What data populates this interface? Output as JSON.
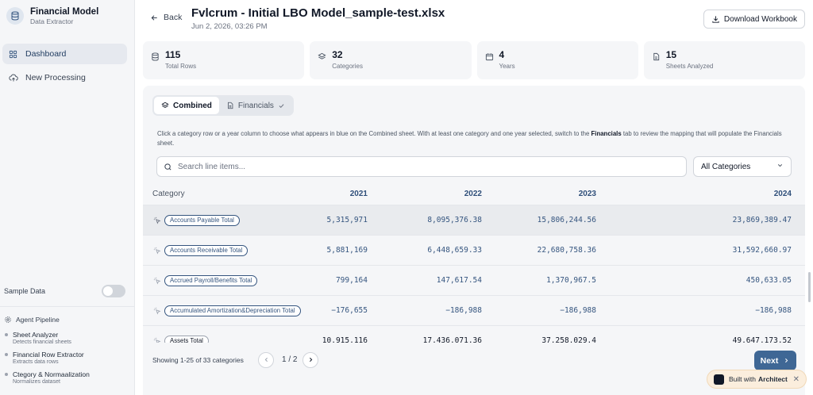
{
  "sidebar": {
    "app_title": "Financial Model",
    "app_subtitle": "Data Extractor",
    "nav": [
      {
        "label": "Dashboard",
        "icon": "grid-icon",
        "active": true
      },
      {
        "label": "New Processing",
        "icon": "cloud-upload-icon",
        "active": false
      }
    ],
    "sample_data_label": "Sample Data",
    "sample_data_on": false,
    "pipeline_title": "Agent Pipeline",
    "pipeline": [
      {
        "name": "Sheet Analyzer",
        "desc": "Detects financial sheets"
      },
      {
        "name": "Financial Row Extractor",
        "desc": "Extracts data rows"
      },
      {
        "name": "Ctegory & Normaalization",
        "desc": "Normalizes dataset"
      }
    ]
  },
  "header": {
    "back_label": "Back",
    "file_title": "Fvlcrum - Initial LBO Model_sample-test.xlsx",
    "file_date": "Jun 2, 2026, 03:26 PM",
    "download_label": "Download Workbook"
  },
  "stats": [
    {
      "value": "115",
      "label": "Total Rows",
      "icon": "database-icon"
    },
    {
      "value": "32",
      "label": "Categories",
      "icon": "layers-icon"
    },
    {
      "value": "4",
      "label": "Years",
      "icon": "calendar-icon"
    },
    {
      "value": "15",
      "label": "Sheets Analyzed",
      "icon": "file-icon"
    }
  ],
  "tabs": [
    {
      "label": "Combined",
      "active": true
    },
    {
      "label": "Financials",
      "active": false
    }
  ],
  "help": {
    "part1": "Click a category row or a year column to choose what appears in blue on the Combined sheet. With at least one category and one year selected, switch to the ",
    "bold": "Financials",
    "part2": " tab to review the mapping that will populate the Financials sheet."
  },
  "search": {
    "placeholder": "Search line items...",
    "value": ""
  },
  "category_filter": "All Categories",
  "table": {
    "category_header": "Category",
    "years": [
      "2021",
      "2022",
      "2023",
      "2024"
    ],
    "rows": [
      {
        "category": "Accounts Payable Total",
        "values": [
          "5,315,971",
          "8,095,376.38",
          "15,806,244.56",
          "23,869,389.47"
        ],
        "selected": true
      },
      {
        "category": "Accounts Receivable Total",
        "values": [
          "5,881,169",
          "6,448,659.33",
          "22,680,758.36",
          "31,592,660.97"
        ],
        "selected": true
      },
      {
        "category": "Accrued Payroll/Benefits Total",
        "values": [
          "799,164",
          "147,617.54",
          "1,370,967.5",
          "450,633.05"
        ],
        "selected": true
      },
      {
        "category": "Accumulated Amortization&Depreciation Total",
        "values": [
          "−176,655",
          "−186,988",
          "−186,988",
          "−186,988"
        ],
        "selected": true
      },
      {
        "category": "Assets Total",
        "values": [
          "10,915,116",
          "17,436,071.36",
          "37,258,029.4",
          "49,647,173.52"
        ],
        "selected": false
      }
    ]
  },
  "pagination": {
    "info": "Showing 1-25 of 33 categories",
    "page_text": "1 / 2",
    "next_label": "Next"
  },
  "badge": {
    "prefix": "Built with",
    "brand": "Architect",
    "close": "✕"
  },
  "colors": {
    "accent": "#3f6795",
    "selected_text": "#35557f",
    "panel_bg": "#f5f6f8"
  }
}
